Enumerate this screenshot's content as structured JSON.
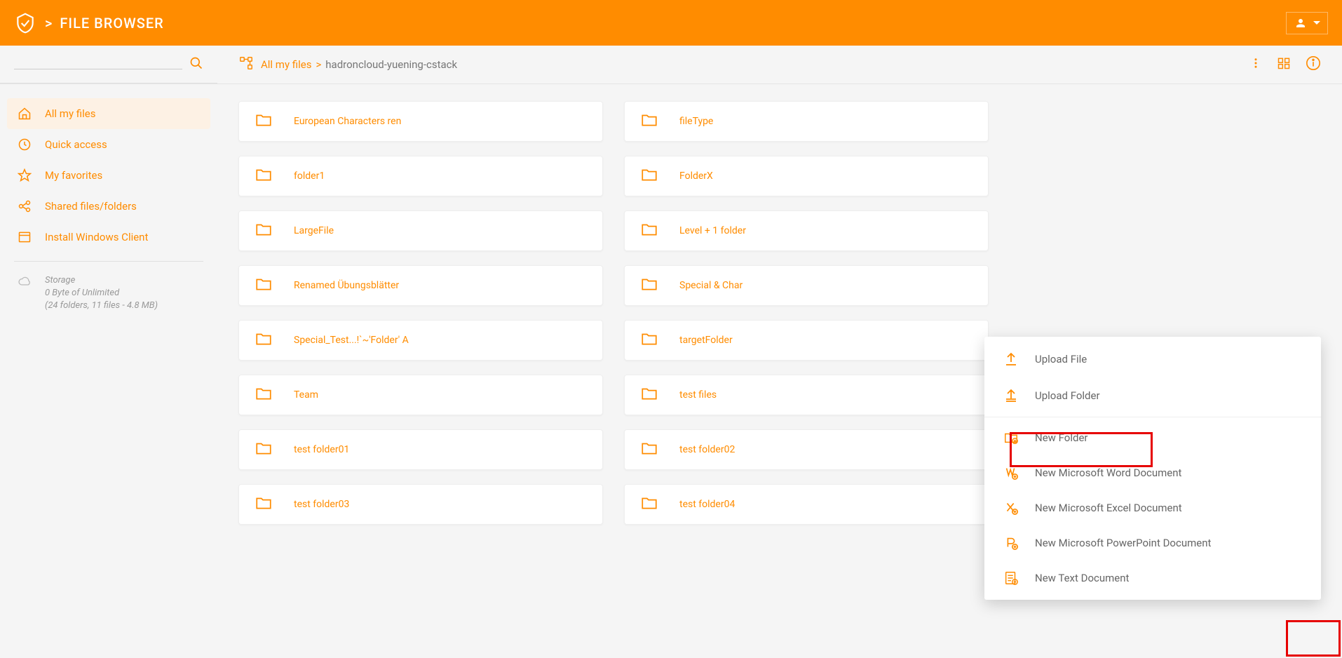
{
  "header": {
    "title": "FILE BROWSER",
    "sep": ">"
  },
  "breadcrumb": {
    "root": "All my files",
    "sep": ">",
    "current": "hadroncloud-yuening-cstack"
  },
  "sidebar": {
    "items": [
      {
        "label": "All my files"
      },
      {
        "label": "Quick access"
      },
      {
        "label": "My favorites"
      },
      {
        "label": "Shared files/folders"
      },
      {
        "label": "Install Windows Client"
      }
    ],
    "storage": {
      "title": "Storage",
      "line1": "0 Byte of Unlimited",
      "line2": "(24 folders, 11 files - 4.8 MB)"
    }
  },
  "folders": [
    "European Characters ren",
    "fileType",
    "folder1",
    "FolderX",
    "LargeFile",
    "Level + 1 folder",
    "Renamed Übungsblätter",
    "Special & Char",
    "Special_Test...!`~'Folder' A",
    "targetFolder",
    "Team",
    "test files",
    "test folder01",
    "test folder02",
    "test folder03",
    "test folder04"
  ],
  "menu": {
    "upload_file": "Upload File",
    "upload_folder": "Upload Folder",
    "new_folder": "New Folder",
    "new_word": "New Microsoft Word Document",
    "new_excel": "New Microsoft Excel Document",
    "new_ppt": "New Microsoft PowerPoint Document",
    "new_text": "New Text Document"
  }
}
